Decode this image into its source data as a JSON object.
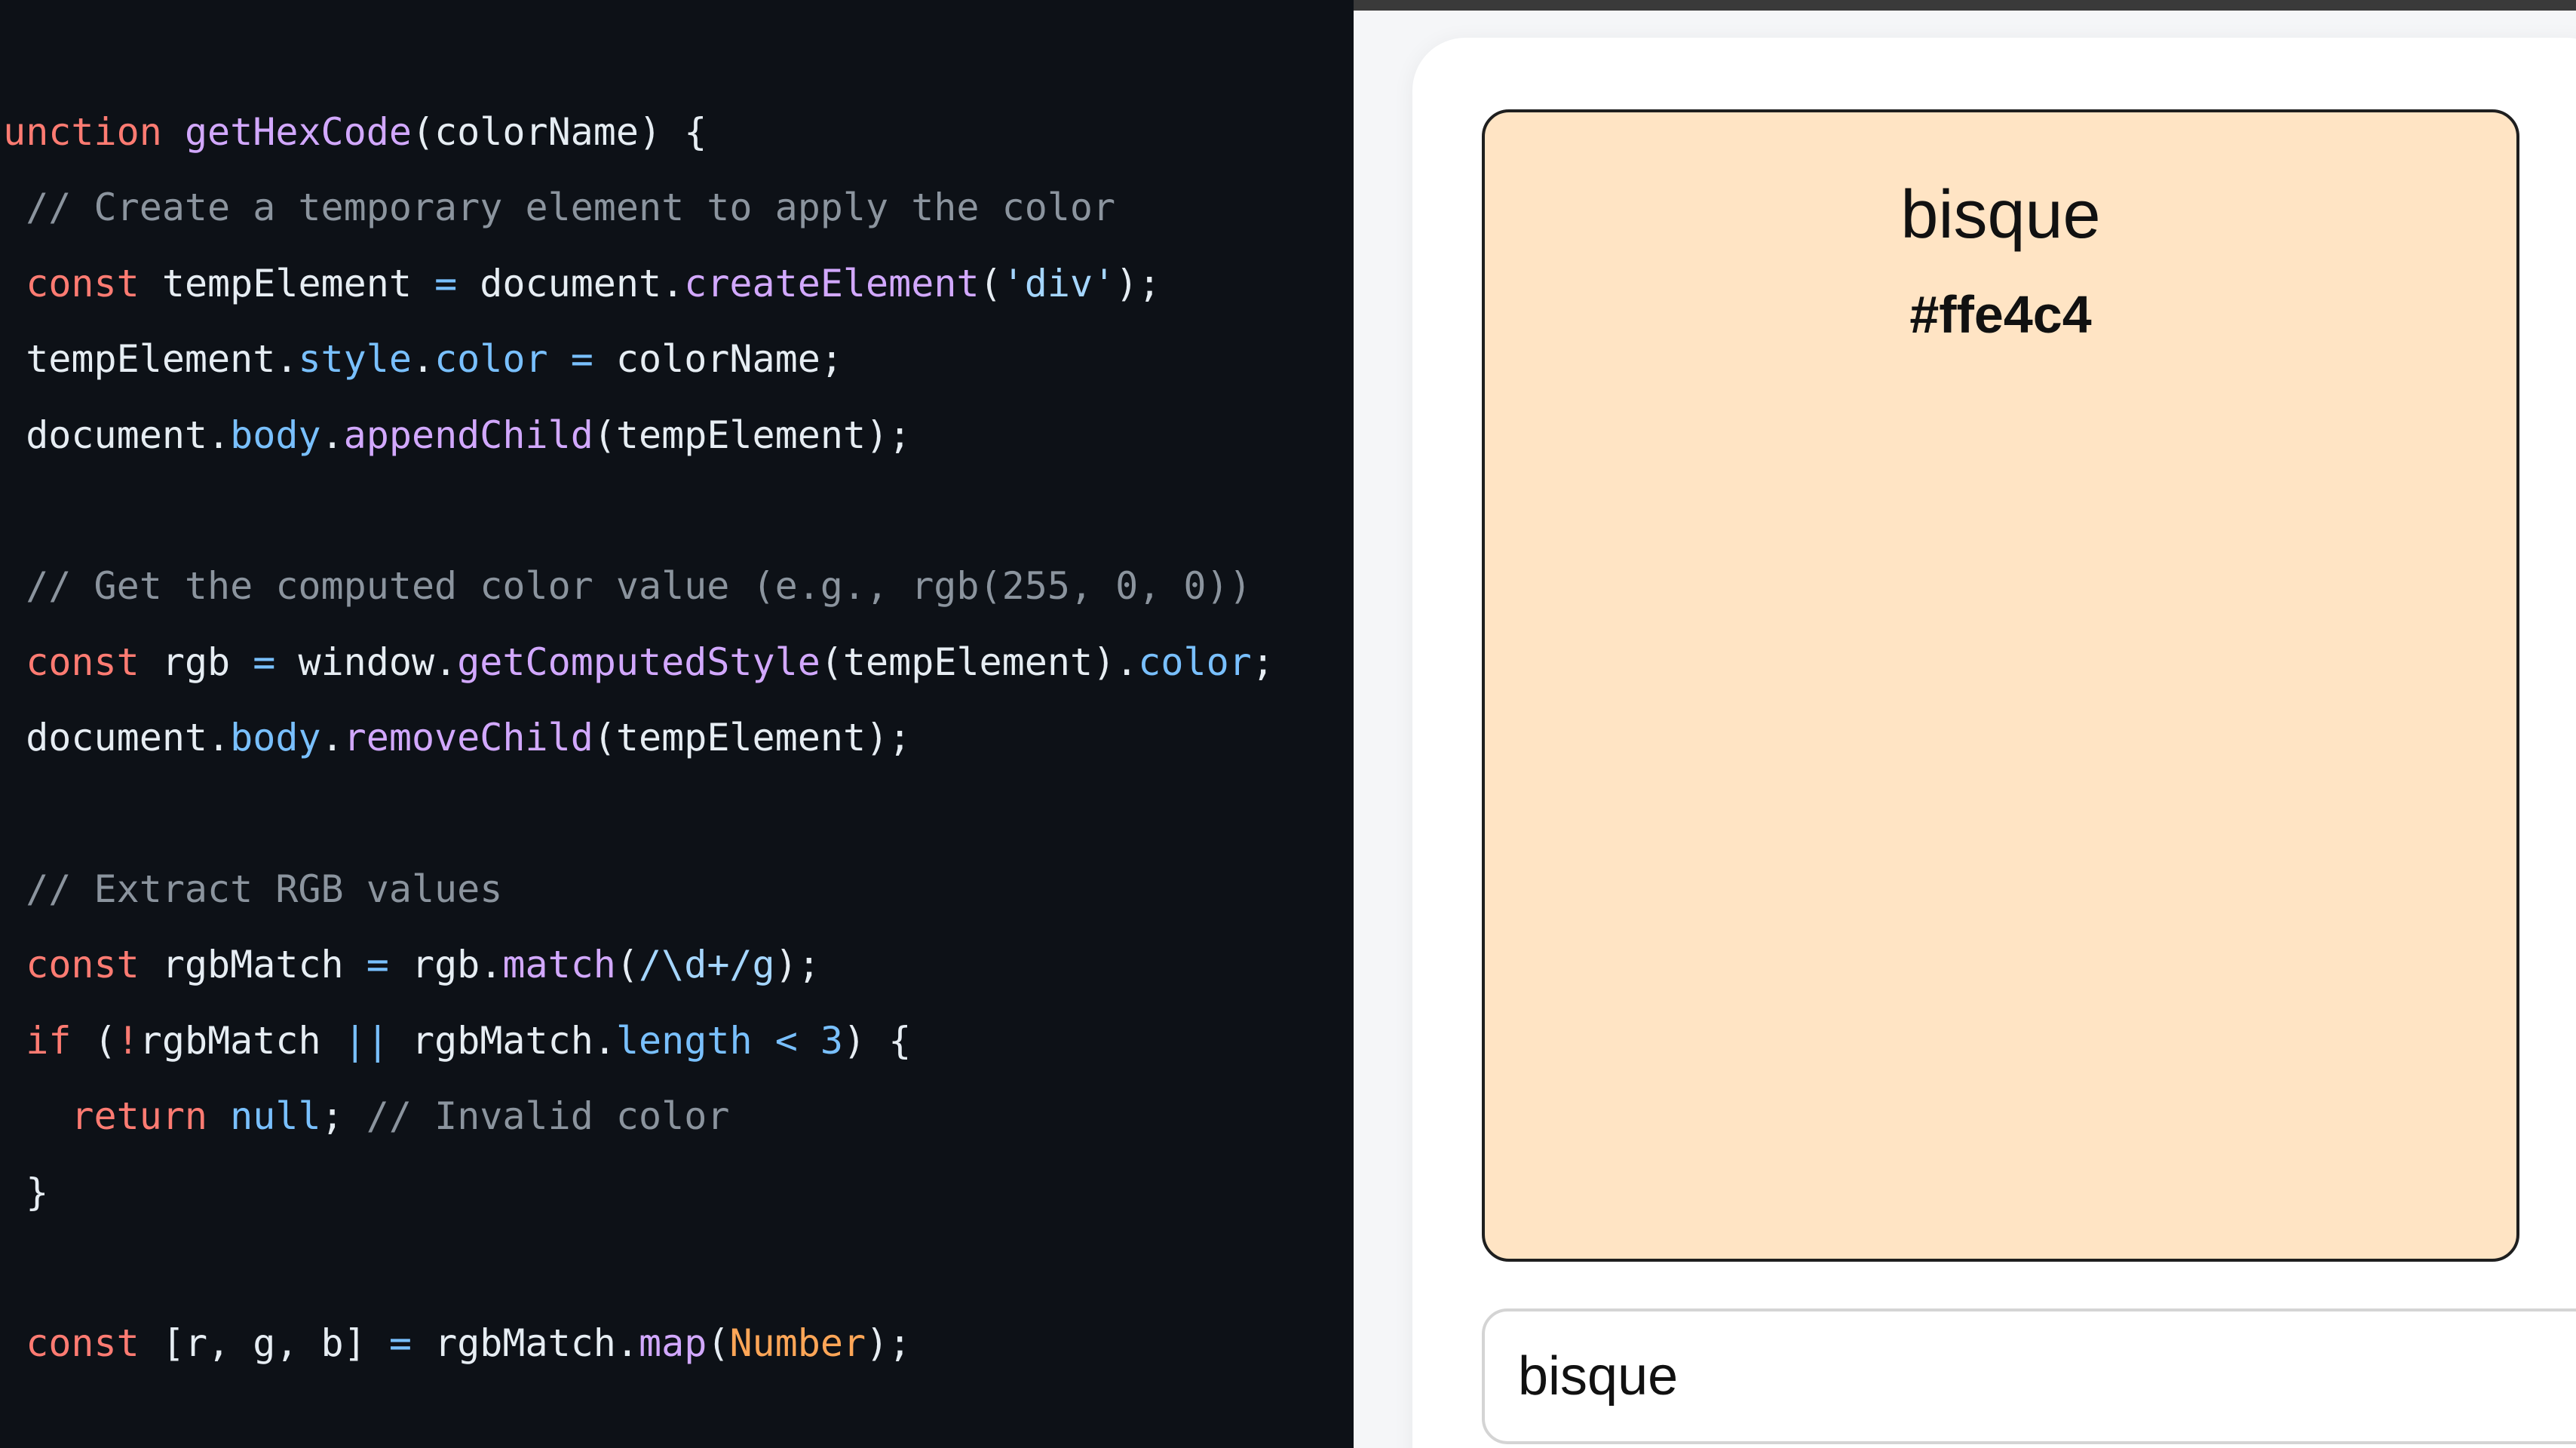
{
  "code_panel": {
    "lines": [
      [
        {
          "t": "function ",
          "c": "keyword"
        },
        {
          "t": "getHexCode",
          "c": "func"
        },
        {
          "t": "(colorName) {",
          "c": "plain"
        }
      ],
      [
        {
          "t": "  // Create a temporary element to apply the color",
          "c": "comment"
        }
      ],
      [
        {
          "t": "  ",
          "c": "plain"
        },
        {
          "t": "const",
          "c": "keyword"
        },
        {
          "t": " tempElement ",
          "c": "plain"
        },
        {
          "t": "=",
          "c": "op"
        },
        {
          "t": " document.",
          "c": "plain"
        },
        {
          "t": "createElement",
          "c": "func"
        },
        {
          "t": "(",
          "c": "plain"
        },
        {
          "t": "'div'",
          "c": "string"
        },
        {
          "t": ");",
          "c": "plain"
        }
      ],
      [
        {
          "t": "  tempElement.",
          "c": "plain"
        },
        {
          "t": "style",
          "c": "prop"
        },
        {
          "t": ".",
          "c": "plain"
        },
        {
          "t": "color",
          "c": "prop"
        },
        {
          "t": " ",
          "c": "plain"
        },
        {
          "t": "=",
          "c": "op"
        },
        {
          "t": " colorName;",
          "c": "plain"
        }
      ],
      [
        {
          "t": "  document.",
          "c": "plain"
        },
        {
          "t": "body",
          "c": "prop"
        },
        {
          "t": ".",
          "c": "plain"
        },
        {
          "t": "appendChild",
          "c": "func"
        },
        {
          "t": "(tempElement);",
          "c": "plain"
        }
      ],
      [],
      [
        {
          "t": "  // Get the computed color value (e.g., rgb(255, 0, 0))",
          "c": "comment"
        }
      ],
      [
        {
          "t": "  ",
          "c": "plain"
        },
        {
          "t": "const",
          "c": "keyword"
        },
        {
          "t": " rgb ",
          "c": "plain"
        },
        {
          "t": "=",
          "c": "op"
        },
        {
          "t": " window.",
          "c": "plain"
        },
        {
          "t": "getComputedStyle",
          "c": "func"
        },
        {
          "t": "(tempElement).",
          "c": "plain"
        },
        {
          "t": "color",
          "c": "prop"
        },
        {
          "t": ";",
          "c": "plain"
        }
      ],
      [
        {
          "t": "  document.",
          "c": "plain"
        },
        {
          "t": "body",
          "c": "prop"
        },
        {
          "t": ".",
          "c": "plain"
        },
        {
          "t": "removeChild",
          "c": "func"
        },
        {
          "t": "(tempElement);",
          "c": "plain"
        }
      ],
      [],
      [
        {
          "t": "  // Extract RGB values",
          "c": "comment"
        }
      ],
      [
        {
          "t": "  ",
          "c": "plain"
        },
        {
          "t": "const",
          "c": "keyword"
        },
        {
          "t": " rgbMatch ",
          "c": "plain"
        },
        {
          "t": "=",
          "c": "op"
        },
        {
          "t": " rgb.",
          "c": "plain"
        },
        {
          "t": "match",
          "c": "func"
        },
        {
          "t": "(",
          "c": "plain"
        },
        {
          "t": "/\\d+/g",
          "c": "string"
        },
        {
          "t": ");",
          "c": "plain"
        }
      ],
      [
        {
          "t": "  ",
          "c": "plain"
        },
        {
          "t": "if",
          "c": "keyword"
        },
        {
          "t": " (",
          "c": "plain"
        },
        {
          "t": "!",
          "c": "keyword"
        },
        {
          "t": "rgbMatch ",
          "c": "plain"
        },
        {
          "t": "||",
          "c": "op"
        },
        {
          "t": " rgbMatch.",
          "c": "plain"
        },
        {
          "t": "length",
          "c": "prop"
        },
        {
          "t": " ",
          "c": "plain"
        },
        {
          "t": "<",
          "c": "op"
        },
        {
          "t": " ",
          "c": "plain"
        },
        {
          "t": "3",
          "c": "number"
        },
        {
          "t": ") {",
          "c": "plain"
        }
      ],
      [
        {
          "t": "    ",
          "c": "plain"
        },
        {
          "t": "return",
          "c": "keyword"
        },
        {
          "t": " ",
          "c": "plain"
        },
        {
          "t": "null",
          "c": "prop"
        },
        {
          "t": "; ",
          "c": "plain"
        },
        {
          "t": "// Invalid color",
          "c": "comment"
        }
      ],
      [
        {
          "t": "  }",
          "c": "plain"
        }
      ],
      [],
      [
        {
          "t": "  ",
          "c": "plain"
        },
        {
          "t": "const",
          "c": "keyword"
        },
        {
          "t": " [r, g, b] ",
          "c": "plain"
        },
        {
          "t": "=",
          "c": "op"
        },
        {
          "t": " rgbMatch.",
          "c": "plain"
        },
        {
          "t": "map",
          "c": "func"
        },
        {
          "t": "(",
          "c": "plain"
        },
        {
          "t": "Number",
          "c": "builtin"
        },
        {
          "t": ");",
          "c": "plain"
        }
      ]
    ]
  },
  "preview": {
    "name": "bisque",
    "hex": "#ffe4c4",
    "swatch_color": "#ffe4c4"
  },
  "input": {
    "value": "bisque"
  }
}
